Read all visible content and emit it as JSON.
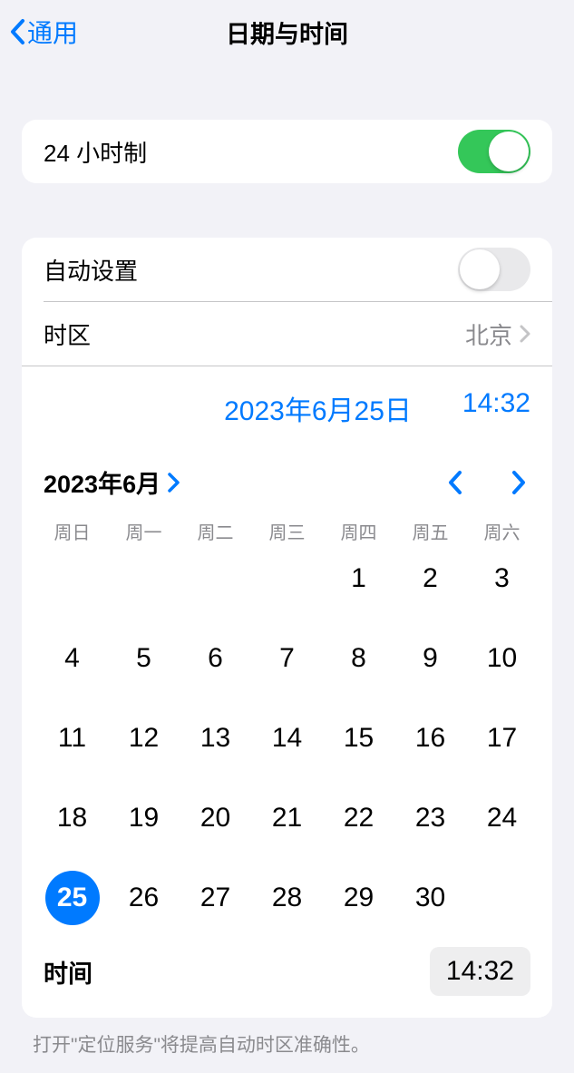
{
  "header": {
    "back_label": "通用",
    "title": "日期与时间"
  },
  "group1": {
    "hour24_label": "24 小时制",
    "hour24_on": true
  },
  "group2": {
    "auto_label": "自动设置",
    "auto_on": false,
    "timezone_label": "时区",
    "timezone_value": "北京",
    "selected_date_display": "2023年6月25日",
    "selected_time_display": "14:32",
    "month_title": "2023年6月",
    "weekdays": [
      "周日",
      "周一",
      "周二",
      "周三",
      "周四",
      "周五",
      "周六"
    ],
    "calendar": {
      "leading_blanks": 4,
      "days_in_month": 30,
      "selected_day": 25
    },
    "time_label": "时间",
    "time_value": "14:32"
  },
  "footer": {
    "note": "打开\"定位服务\"将提高自动时区准确性。"
  }
}
